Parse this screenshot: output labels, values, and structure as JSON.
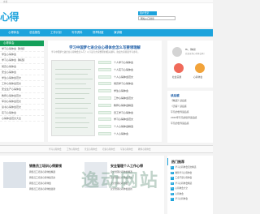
{
  "topbar": {
    "text": "文档"
  },
  "header": {
    "logo": "心得"
  },
  "search": {
    "button_label": "用户登录",
    "input_value": "网站入口搜索"
  },
  "nav": {
    "items": [
      "心得体会",
      "总结报告",
      "工作计划",
      "写作资料",
      "规章制度",
      "演讲稿"
    ]
  },
  "left": {
    "head": "心得体会",
    "items": [
      "学习心得体会【新版】",
      "学生心得体会",
      "学习心得体会【精选】",
      "党员心得体会",
      "安全心得体会",
      "学生心得体会范文",
      "工作心得体会范文",
      "安全生产心得体会",
      "教师心得体会范文",
      "军训心得体会范文",
      "读书心得体会范文",
      "实习心得体会",
      "心得体会范文大全"
    ]
  },
  "center": {
    "title": "学习中国梦七进企业心得体会怎么写要领理解",
    "desc": "学习中国梦七进企业心得体会怎么写？以下是为大家整理的相关资料，欢迎大家阅读学习参考。",
    "items": [
      "个人学习心得体会",
      "个人实习心得体会",
      "个人心得体会范文",
      "党员学习心得体会",
      "学生心得体会",
      "工作心得体会范文",
      "教师心得体会精选",
      "员工学习心得体会",
      "学习心得体会范文",
      "个人心得体会精选",
      "个人心得体会",
      "学习心得体会",
      "个人心得体会范文"
    ]
  },
  "user": {
    "greeting": "Hi，你好！",
    "sub": "欢迎来到心得体会网！",
    "actions": [
      "社会实践",
      "心得体会"
    ]
  },
  "recommend": {
    "head": "读后感",
    "items": [
      "【精选】读后感",
      "《活着》读后感",
      "平凡的世界读后感",
      "2020年平凡的世界读后感",
      "平凡的世界读后感"
    ]
  },
  "midnav": {
    "items": [
      "学习心得体会",
      "工作心得体会",
      "党员心得体会",
      "培训心得体会",
      "军训心得体会",
      "教师心得体会"
    ]
  },
  "cards": [
    {
      "title": "销售员工培训心得要领",
      "items": [
        "销售员工培训心得体会精选",
        "销售员工培训心得体会范文",
        "销售员工培训心得体会",
        "销售员工培训心得体会最新"
      ]
    },
    {
      "title": "安全管理个人工作心得",
      "items": [
        "安全管理心得体会精选",
        "安全管理心得体会范文",
        "安全管理心得体会",
        "安全管理心得体会最新"
      ]
    }
  ],
  "hot": {
    "head": "热门推荐",
    "items": [
      "学习心得体会范文精选",
      "教师学习心得体会",
      "工会干部心得体会",
      "学习心得体会精选",
      "心得体会大全",
      "心得体会",
      "学习心得体会"
    ]
  },
  "watermark": "逸动网站",
  "colors": {
    "primary": "#1ca3dc",
    "green": "#14a05a",
    "title_blue": "#1f5fa8"
  }
}
